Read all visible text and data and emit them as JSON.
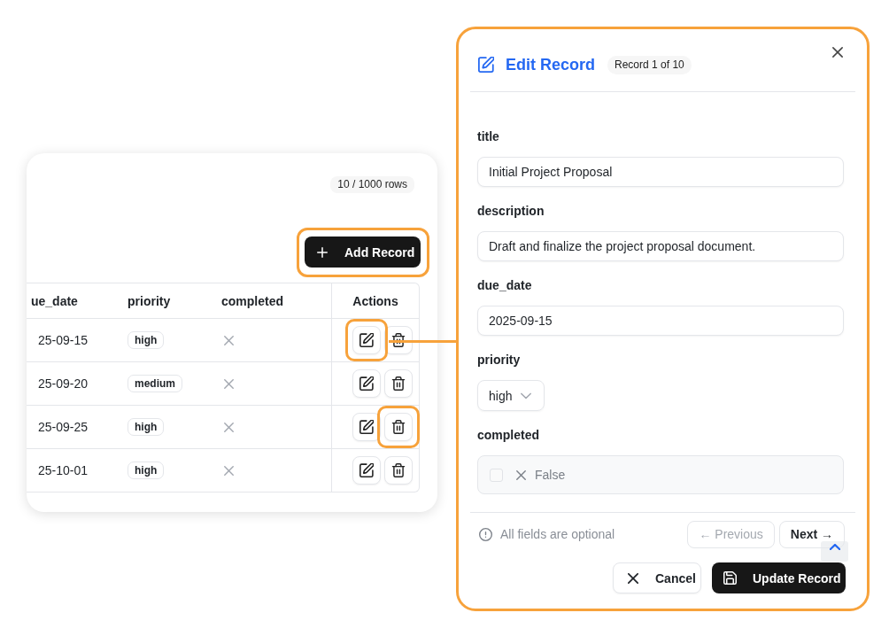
{
  "table_card": {
    "row_count_badge": "10 / 1000 rows",
    "add_button": {
      "label": "Add Record",
      "highlighted": true
    },
    "table": {
      "columns": [
        "ue_date",
        "priority",
        "completed",
        "Actions"
      ],
      "rows": [
        {
          "column_1": "25-09-15",
          "priority": "high",
          "completed": false,
          "actions": [
            {
              "kind": "edit",
              "highlighted": true
            },
            {
              "kind": "delete",
              "highlighted": false
            }
          ]
        },
        {
          "column_1": "25-09-20",
          "priority": "medium",
          "completed": false,
          "actions": [
            {
              "kind": "edit",
              "highlighted": false
            },
            {
              "kind": "delete",
              "highlighted": false
            }
          ]
        },
        {
          "column_1": "25-09-25",
          "priority": "high",
          "completed": false,
          "actions": [
            {
              "kind": "edit",
              "highlighted": false
            },
            {
              "kind": "delete",
              "highlighted": true
            }
          ]
        },
        {
          "column_1": "25-10-01",
          "priority": "high",
          "completed": false,
          "actions": [
            {
              "kind": "edit",
              "highlighted": false
            },
            {
              "kind": "delete",
              "highlighted": false
            }
          ]
        }
      ]
    }
  },
  "dialog": {
    "highlighted": true,
    "title": "Edit Record",
    "record_badge": "Record 1 of 10",
    "fields": [
      {
        "kind": "text",
        "label": "title",
        "value": "Initial Project Proposal"
      },
      {
        "kind": "text",
        "label": "description",
        "value": "Draft and finalize the project proposal document."
      },
      {
        "kind": "text",
        "label": "due_date",
        "value": "2025-09-15"
      },
      {
        "kind": "select",
        "label": "priority",
        "value": "high"
      },
      {
        "kind": "checkbox",
        "label": "completed",
        "checked": false,
        "value": "False"
      }
    ],
    "hint": "All fields are optional",
    "nav_buttons": [
      {
        "label": "← Previous",
        "disabled": true
      },
      {
        "label": "Next →",
        "disabled": false
      }
    ],
    "cancel_button": "Cancel",
    "submit_button": "Update Record"
  }
}
